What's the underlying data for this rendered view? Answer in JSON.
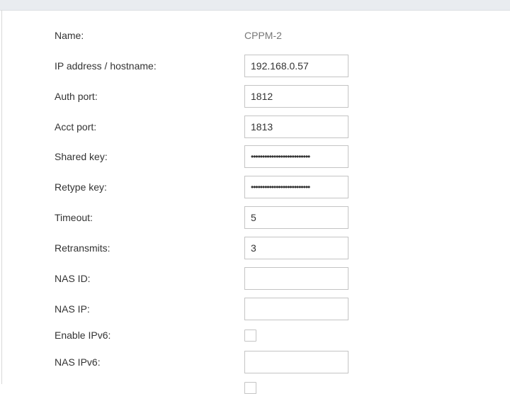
{
  "form": {
    "name_label": "Name:",
    "name_value": "CPPM-2",
    "ip_label": "IP address / hostname:",
    "ip_value": "192.168.0.57",
    "auth_port_label": "Auth port:",
    "auth_port_value": "1812",
    "acct_port_label": "Acct port:",
    "acct_port_value": "1813",
    "shared_key_label": "Shared key:",
    "shared_key_value": "••••••••••••••••••••••••••",
    "retype_key_label": "Retype key:",
    "retype_key_value": "••••••••••••••••••••••••••",
    "timeout_label": "Timeout:",
    "timeout_value": "5",
    "retransmits_label": "Retransmits:",
    "retransmits_value": "3",
    "nas_id_label": "NAS ID:",
    "nas_id_value": "",
    "nas_ip_label": "NAS IP:",
    "nas_ip_value": "",
    "enable_ipv6_label": "Enable IPv6:",
    "enable_ipv6_checked": false,
    "nas_ipv6_label": "NAS IPv6:",
    "nas_ipv6_value": ""
  }
}
